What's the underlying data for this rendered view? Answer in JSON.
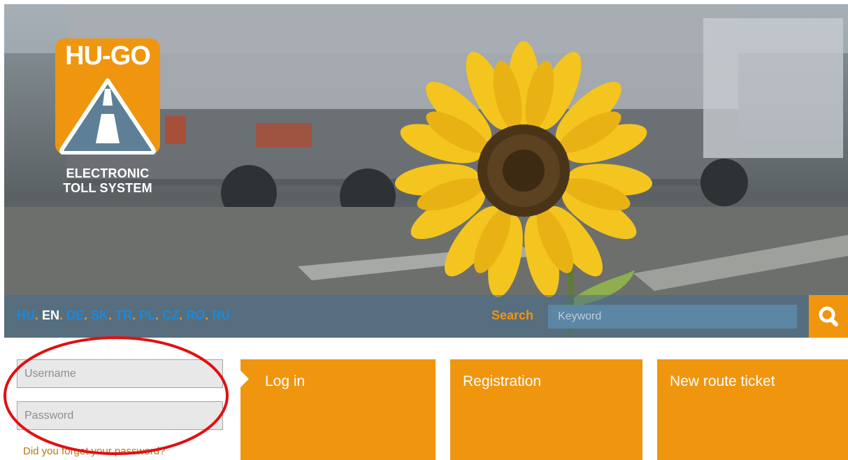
{
  "logo": {
    "wordmark": "HU-GO",
    "caption_line1": "ELECTRONIC",
    "caption_line2": "TOLL SYSTEM"
  },
  "languages": [
    {
      "code": "HU",
      "active": false
    },
    {
      "code": "EN",
      "active": true
    },
    {
      "code": "DE",
      "active": false
    },
    {
      "code": "SK",
      "active": false
    },
    {
      "code": "TR",
      "active": false
    },
    {
      "code": "PL",
      "active": false
    },
    {
      "code": "CZ",
      "active": false
    },
    {
      "code": "RO",
      "active": false
    },
    {
      "code": "RU",
      "active": false
    }
  ],
  "language_separator": ".",
  "search": {
    "label": "Search",
    "placeholder": "Keyword",
    "button_icon": "search-icon"
  },
  "login_form": {
    "username_placeholder": "Username",
    "password_placeholder": "Password",
    "forgot_link": "Did you forget your password?"
  },
  "tiles": {
    "login": "Log in",
    "registration": "Registration",
    "route_ticket": "New route ticket"
  },
  "colors": {
    "brand_orange": "#f0950e",
    "language_link": "#1e88d6",
    "highlight_red": "#e01010"
  }
}
